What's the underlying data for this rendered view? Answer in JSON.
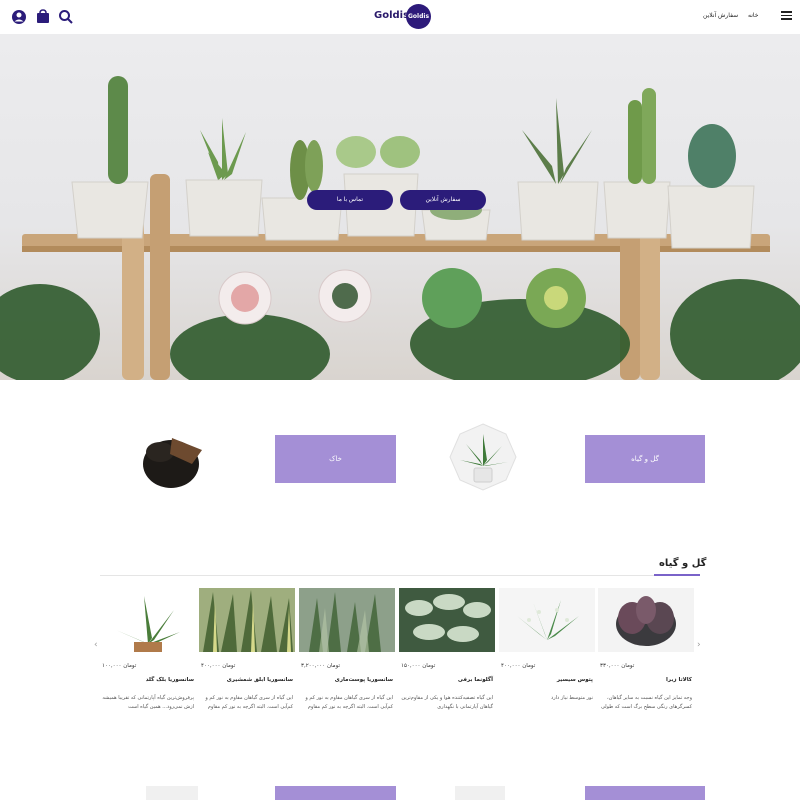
{
  "header": {
    "logo_text": "Goldis",
    "logo_badge": "Goldis",
    "nav": {
      "home": "خانه",
      "order_online": "سفارش آنلاین"
    },
    "icons": [
      "user-icon",
      "cart-icon",
      "search-icon",
      "menu-icon"
    ]
  },
  "hero": {
    "order_button": "سفارش آنلاین",
    "contact_button": "تماس با ما"
  },
  "categories": {
    "soil": "خاک",
    "plants": "گل و گیاه"
  },
  "section": {
    "title": "گل و گیاه"
  },
  "products": [
    {
      "name": "کالاتا زبرا",
      "price": "۳۳۰,۰۰۰ تومان",
      "desc": "وجه تمایز این گیاه نسبت به سایر گیاهان، کسرگرهای رنگی سطح برگ است که طولی"
    },
    {
      "name": "پتوس سیسیر",
      "price": "۴۰۰,۰۰۰ تومان",
      "desc": "نور متوسط نیاز دارد"
    },
    {
      "name": "آگلونما برفی",
      "price": "۱۵۰,۰۰۰ تومان",
      "desc": "این گیاه تصفیه‌کننده هوا و یکی از مقاوم‌ترین گیاهان آپارتمانی با نگهداری"
    },
    {
      "name": "سانسوریا پوست‌ماری",
      "price": "۳,۲۰۰,۰۰۰ تومان",
      "desc": "این گیاه از سری گیاهان مقاوم به نور کم و کم‌آبی است. البته اگرچه به نور کم مقاوم"
    },
    {
      "name": "سانسوریا ابلق شمشیری",
      "price": "۴۰۰,۰۰۰ تومان",
      "desc": "این گیاه از سری گیاهان مقاوم به نور کم و کم‌آبی است. البته اگرچه به نور کم مقاوم"
    },
    {
      "name": "سانسوریا بلک گلد",
      "price": "۱۰۰,۰۰۰ تومان",
      "desc": "پرفروش‌ترین گیاه آپارتمانی که تقریبا همیشه ازش نمی‌رود... همین گیاه است"
    }
  ],
  "colors": {
    "brand": "#2b1c7a",
    "accent": "#a48fd6"
  }
}
